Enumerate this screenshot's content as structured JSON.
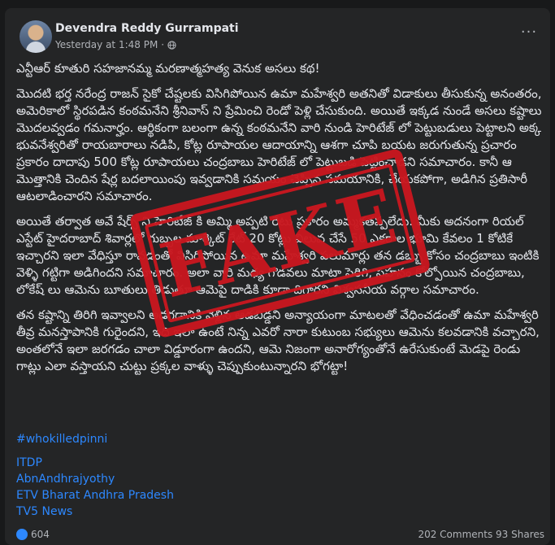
{
  "post": {
    "author": "Devendra Reddy Gurrampati",
    "timestamp": "Yesterday at 1:48 PM",
    "separator": "·",
    "privacy_icon": "globe-icon",
    "more_label": "···",
    "paragraphs": [
      "ఎన్టీఆర్ కూతురి సహజానమ్మ మరణాత్మహత్య వెనుక అసలు కథ!",
      "మొదటి భర్త నరేంద్ర రాజన్ సైకో చేష్టలకు విసిగిపోయిన ఉమా మహేశ్వరి అతనితో విడాకులు తీసుకున్న అనంతరం, అమెరికాలో స్థిరపడిన కంఠమనేని శ్రీనివాస్ ని ప్రేమించి రెండో పెళ్లి చేసుకుంది. అయితే ఇక్కడ నుండే అసలు కష్టాలు మొదలవ్వడం గమనార్హం. ఆర్థికంగా బలంగా ఉన్న కంఠమనేని వారి నుండి హెరిటేజ్ లో పెట్టుబడులు పెట్టాలని అక్క భువనేశ్వరితో రాయబారాలు నడిపి, కోట్ల రూపాయల ఆదాయాన్ని ఆశగా చూపి బయట జరుగుతున్న ప్రచారం ప్రకారం దాదాపు 500 కోట్ల రూపాయలు చంద్రబాబు హెరిటేజ్ లో పెట్టుబడి పెట్టించాడని సమాచారం. కానీ ఆ మొత్తానికి చెందిన షేర్ల బదలాయింపు ఇవ్వడానికి సమయం చెప్పిన సమయానికి, చేయకపోగా, అడిగిన ప్రతిసారీ ఆటలాడించారని సమాచారం.",
      "అయితే తర్వాత అవే షేర్స్ ని హెరిటేజ్ కి అమ్మి అప్పటి రేటు ప్రకారం అమ్మకతప్పలేదు. మీకు అదనంగా రియల్ ఎస్టేట్ హైదరాబాద్ శివార్లలో గుబ్బల మార్కెట్ రేట్ 20 కోట్లు విలువ చేసే 50 ఎకరాల భూమి కేవలం 1 కోటికే ఇచ్చారని ఇలా వేధిస్తూ రావడంతో విసిగిపోయిన ఉమా మహేశ్వరి పలుమార్లు తన డబ్బు కోసం చంద్రబాబు ఇంటికి వెళ్ళి గట్టిగా అడిగిందని సమాచారం. అలా వారి మధ్య గొడవలు మాటా పెరిగి, సహనం కోల్పోయిన చంద్రబాబు, లోకేష్ లు ఆమెను బూతులు తిడుతూ ఆమెపై దాడికి కూడా దిగారని విశ్వసనీయ వర్గాల సమాచారం.",
      "తన కష్టాన్ని తిరిగి ఇవ్వాలని అడగడానికి వెళ్లిన ఆడబిడ్డని అన్యాయంగా మాటలతో వేధించడంతో ఉమా మహేశ్వరి తీవ్ర మనస్తాపానికి గురైందని, ఇది ఇలా ఉంటే నిన్న ఎవరో నారా కుటుంబ సభ్యులు ఆమెను కలవడానికి వచ్చారని, అంతలోనే ఇలా జరగడం చాలా విడ్డూరంగా ఉందని, ఆమె నిజంగా అనారోగ్యంతోనే ఉరేసుకుంటే మెడపై రెండు గాట్లు ఎలా వస్తాయని చుట్టు ప్రక్కల వాళ్ళు చెప్పుకుంటున్నారని భోగట్టా!"
    ],
    "hashtag": "#whokilledpinni",
    "tags": [
      "ITDP",
      "AbnAndhrajyothy",
      "ETV Bharat Andhra Pradesh",
      "TV5 News"
    ],
    "reactions_count": "604",
    "comments_shares": "202 Comments 93 Shares"
  },
  "stamp": {
    "text": "FAKE",
    "color": "#c9171f"
  }
}
